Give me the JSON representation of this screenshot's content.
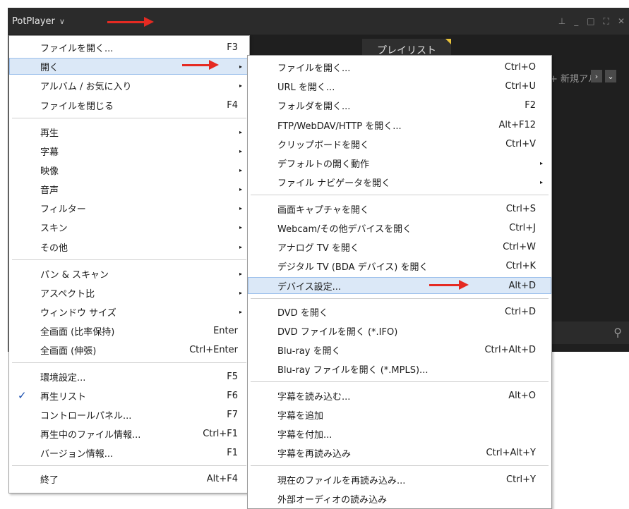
{
  "titlebar": {
    "app_name": "PotPlayer",
    "chevron": "∨",
    "pin": "⊥",
    "minimize": "_",
    "maximize": "□",
    "fullscreen": "⛶",
    "close": "✕"
  },
  "playlist": {
    "tab_label": "プレイリスト",
    "new_album": "+ 新規アル",
    "next_btn": "›",
    "more_btn": "⌄",
    "search_icon": "⚲"
  },
  "main_menu": {
    "items": [
      {
        "label": "ファイルを開く...",
        "shortcut": "F3",
        "submenu": false
      },
      {
        "label": "開く",
        "shortcut": "",
        "submenu": true
      },
      {
        "label": "アルバム / お気に入り",
        "shortcut": "",
        "submenu": true
      },
      {
        "label": "ファイルを閉じる",
        "shortcut": "F4",
        "submenu": false
      },
      {
        "label": "再生",
        "shortcut": "",
        "submenu": true
      },
      {
        "label": "字幕",
        "shortcut": "",
        "submenu": true
      },
      {
        "label": "映像",
        "shortcut": "",
        "submenu": true
      },
      {
        "label": "音声",
        "shortcut": "",
        "submenu": true
      },
      {
        "label": "フィルター",
        "shortcut": "",
        "submenu": true
      },
      {
        "label": "スキン",
        "shortcut": "",
        "submenu": true
      },
      {
        "label": "その他",
        "shortcut": "",
        "submenu": true
      },
      {
        "label": "パン & スキャン",
        "shortcut": "",
        "submenu": true
      },
      {
        "label": "アスペクト比",
        "shortcut": "",
        "submenu": true
      },
      {
        "label": "ウィンドウ サイズ",
        "shortcut": "",
        "submenu": true
      },
      {
        "label": "全画面 (比率保持)",
        "shortcut": "Enter",
        "submenu": false
      },
      {
        "label": "全画面 (伸張)",
        "shortcut": "Ctrl+Enter",
        "submenu": false
      },
      {
        "label": "環境設定...",
        "shortcut": "F5",
        "submenu": false
      },
      {
        "label": "再生リスト",
        "shortcut": "F6",
        "submenu": false,
        "checked": true,
        "check": "✓"
      },
      {
        "label": "コントロールパネル...",
        "shortcut": "F7",
        "submenu": false
      },
      {
        "label": "再生中のファイル情報...",
        "shortcut": "Ctrl+F1",
        "submenu": false
      },
      {
        "label": "バージョン情報...",
        "shortcut": "F1",
        "submenu": false
      },
      {
        "label": "終了",
        "shortcut": "Alt+F4",
        "submenu": false
      }
    ]
  },
  "open_submenu": {
    "items": [
      {
        "label": "ファイルを開く...",
        "shortcut": "Ctrl+O"
      },
      {
        "label": "URL を開く...",
        "shortcut": "Ctrl+U"
      },
      {
        "label": "フォルダを開く...",
        "shortcut": "F2"
      },
      {
        "label": "FTP/WebDAV/HTTP を開く...",
        "shortcut": "Alt+F12"
      },
      {
        "label": "クリップボードを開く",
        "shortcut": "Ctrl+V"
      },
      {
        "label": "デフォルトの開く動作",
        "shortcut": "",
        "submenu": true
      },
      {
        "label": "ファイル ナビゲータを開く",
        "shortcut": "",
        "submenu": true
      },
      {
        "label": "画面キャプチャを開く",
        "shortcut": "Ctrl+S"
      },
      {
        "label": "Webcam/その他デバイスを開く",
        "shortcut": "Ctrl+J"
      },
      {
        "label": "アナログ TV を開く",
        "shortcut": "Ctrl+W"
      },
      {
        "label": "デジタル TV (BDA デバイス) を開く",
        "shortcut": "Ctrl+K"
      },
      {
        "label": "デバイス設定...",
        "shortcut": "Alt+D",
        "highlighted": true
      },
      {
        "label": "DVD を開く",
        "shortcut": "Ctrl+D"
      },
      {
        "label": "DVD ファイルを開く (*.IFO)",
        "shortcut": ""
      },
      {
        "label": "Blu-ray を開く",
        "shortcut": "Ctrl+Alt+D"
      },
      {
        "label": "Blu-ray ファイルを開く (*.MPLS)...",
        "shortcut": ""
      },
      {
        "label": "字幕を読み込む...",
        "shortcut": "Alt+O"
      },
      {
        "label": "字幕を追加",
        "shortcut": ""
      },
      {
        "label": "字幕を付加...",
        "shortcut": ""
      },
      {
        "label": "字幕を再読み込み",
        "shortcut": "Ctrl+Alt+Y"
      },
      {
        "label": "現在のファイルを再読み込み...",
        "shortcut": "Ctrl+Y"
      },
      {
        "label": "外部オーディオの読み込み",
        "shortcut": ""
      }
    ]
  },
  "submenu_arrow": "▸",
  "colors": {
    "accent_arrow": "#e52a22",
    "highlight": "#dbe8f7",
    "player_bg": "#1f1f1f"
  }
}
